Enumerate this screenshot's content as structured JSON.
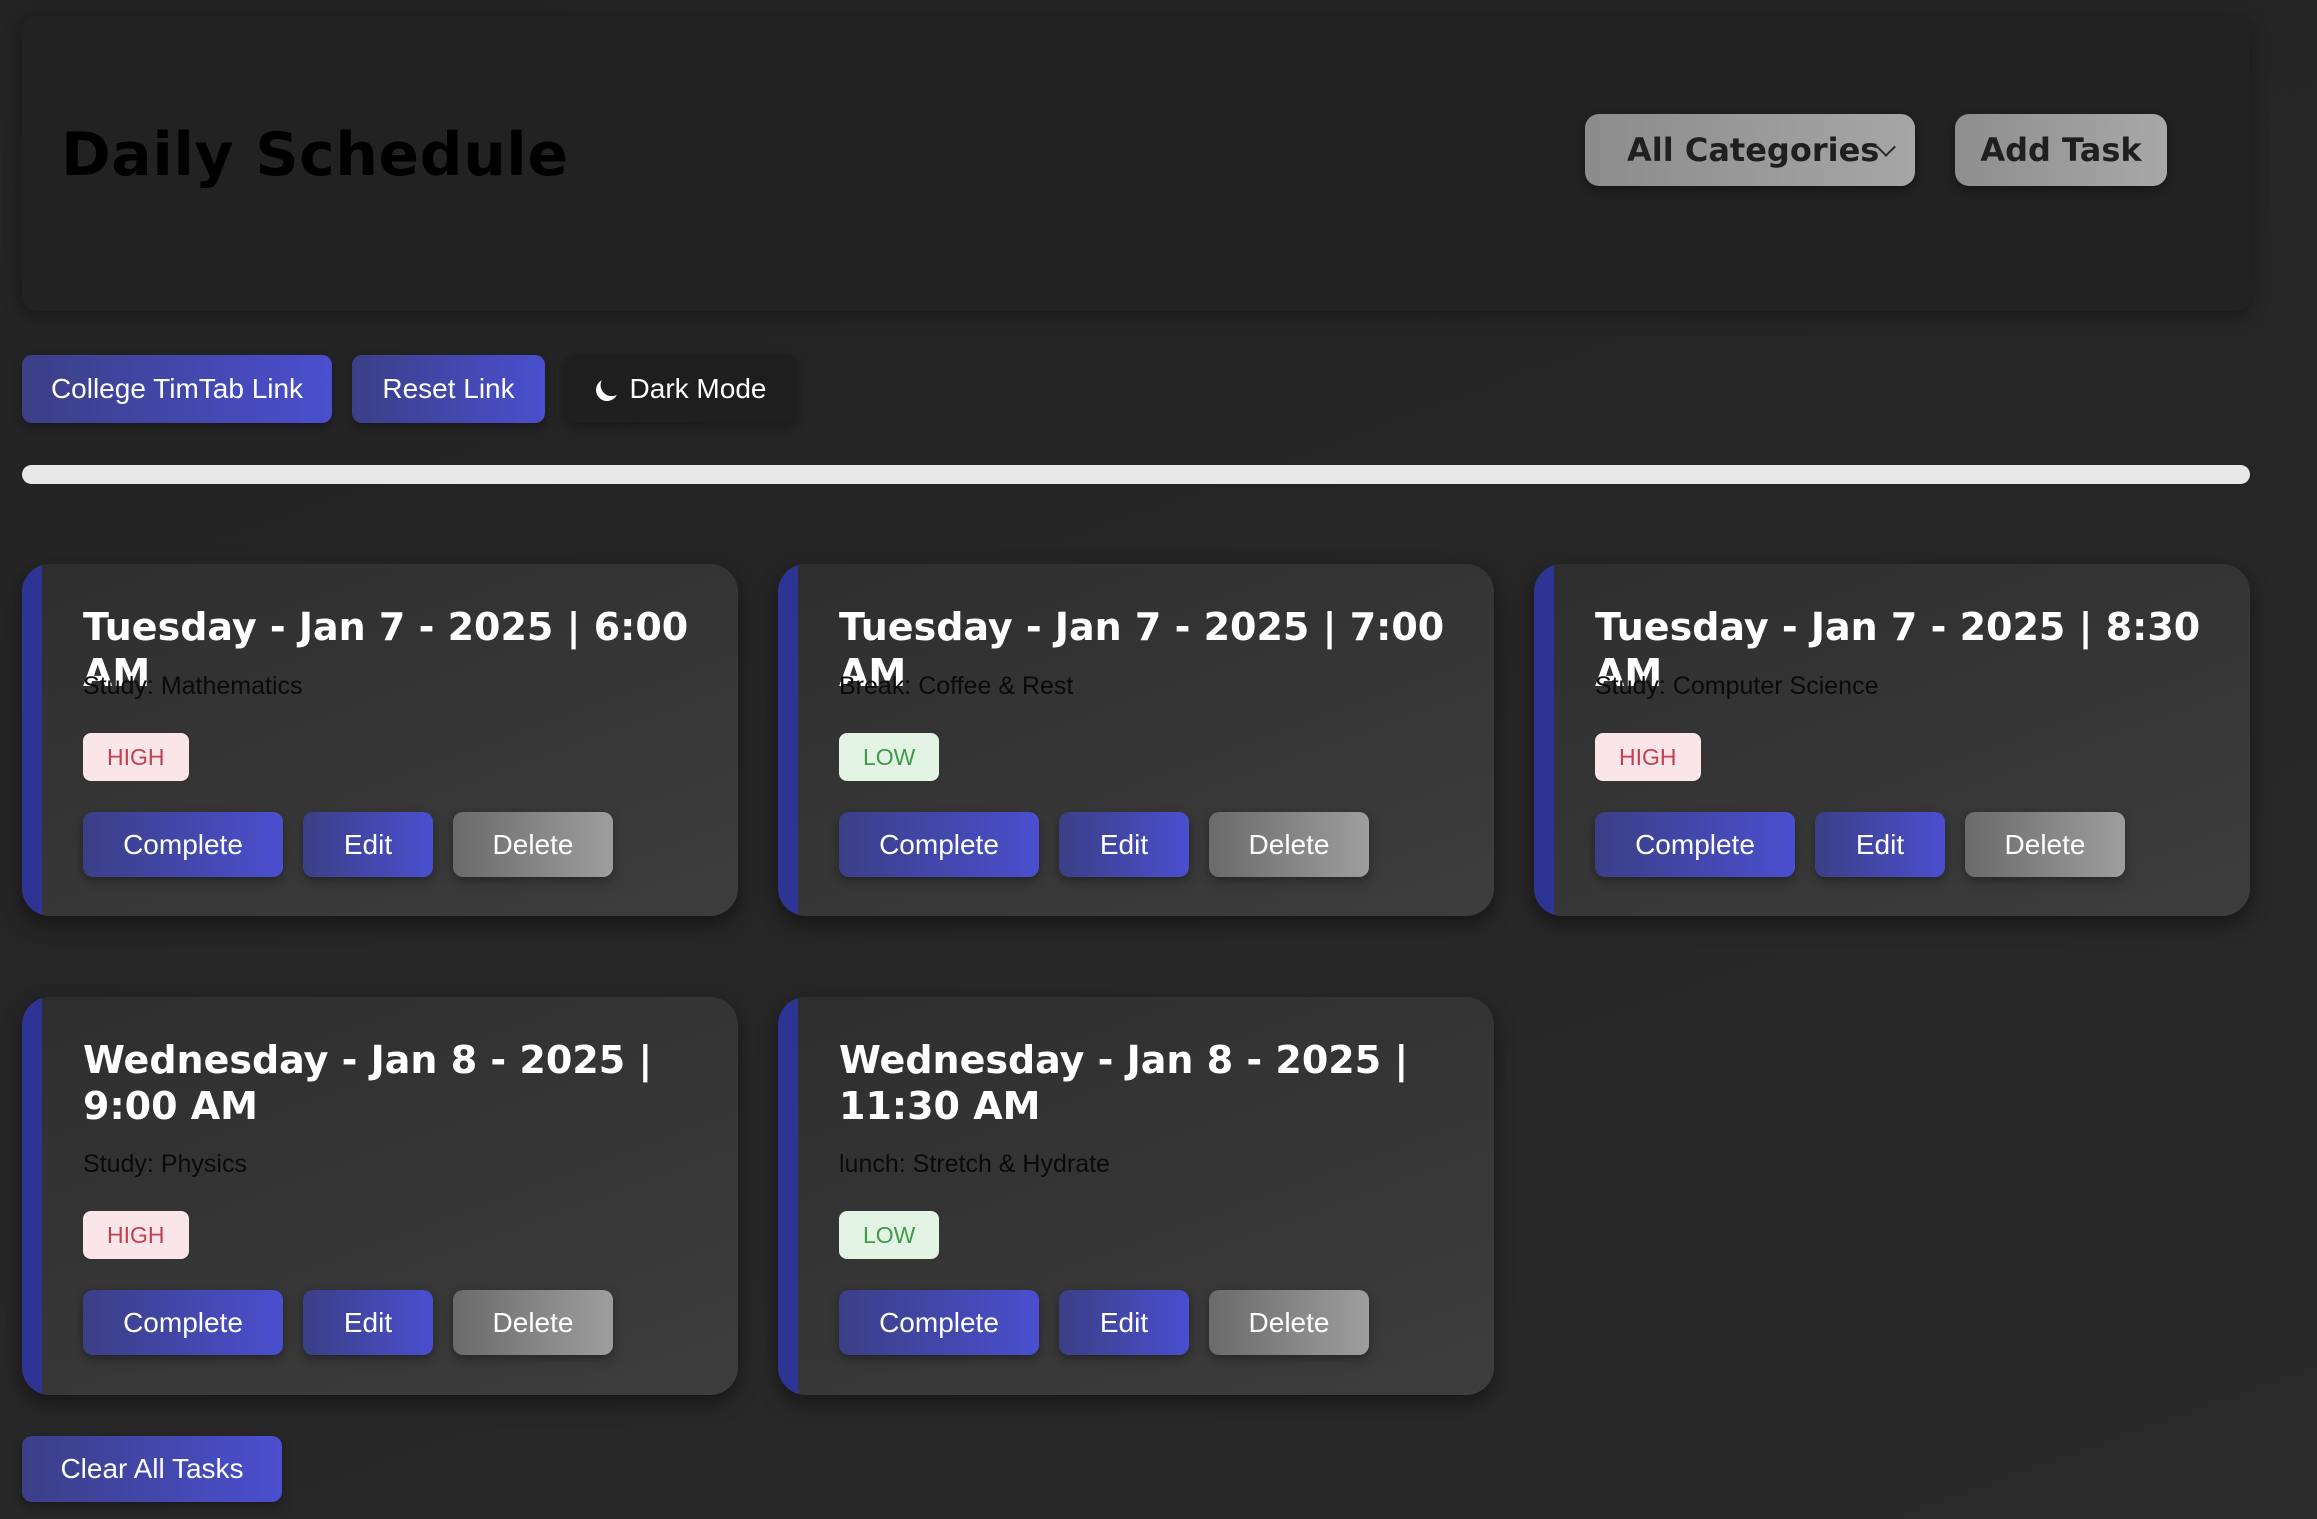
{
  "header": {
    "title": "Daily Schedule",
    "category_select": "All Categories",
    "add_task_label": "Add Task"
  },
  "toolbar": {
    "college_link_label": "College TimTab Link",
    "reset_link_label": "Reset Link",
    "dark_mode_label": "Dark Mode"
  },
  "progress": {
    "value": 0
  },
  "tasks": [
    {
      "title": "Tuesday - Jan 7 - 2025 | 6:00 AM",
      "description": "Study: Mathematics",
      "priority": "HIGH",
      "complete_label": "Complete",
      "edit_label": "Edit",
      "delete_label": "Delete"
    },
    {
      "title": "Tuesday - Jan 7 - 2025 | 7:00 AM",
      "description": "Break: Coffee & Rest",
      "priority": "LOW",
      "complete_label": "Complete",
      "edit_label": "Edit",
      "delete_label": "Delete"
    },
    {
      "title": "Tuesday - Jan 7 - 2025 | 8:30 AM",
      "description": "Study: Computer Science",
      "priority": "HIGH",
      "complete_label": "Complete",
      "edit_label": "Edit",
      "delete_label": "Delete"
    },
    {
      "title": "Wednesday - Jan 8 - 2025 | 9:00 AM",
      "description": "Study: Physics",
      "priority": "HIGH",
      "complete_label": "Complete",
      "edit_label": "Edit",
      "delete_label": "Delete"
    },
    {
      "title": "Wednesday - Jan 8 - 2025 | 11:30 AM",
      "description": "lunch: Stretch & Hydrate",
      "priority": "LOW",
      "complete_label": "Complete",
      "edit_label": "Edit",
      "delete_label": "Delete"
    }
  ],
  "footer": {
    "clear_all_label": "Clear All Tasks"
  },
  "colors": {
    "accent_blue": "#4a4fcf",
    "card_accent": "#2e3494",
    "high_badge_text": "#c34052",
    "low_badge_text": "#3f9a4a"
  },
  "icons": {
    "dark_mode": "moon-icon",
    "category_select": "chevron-down-icon"
  }
}
